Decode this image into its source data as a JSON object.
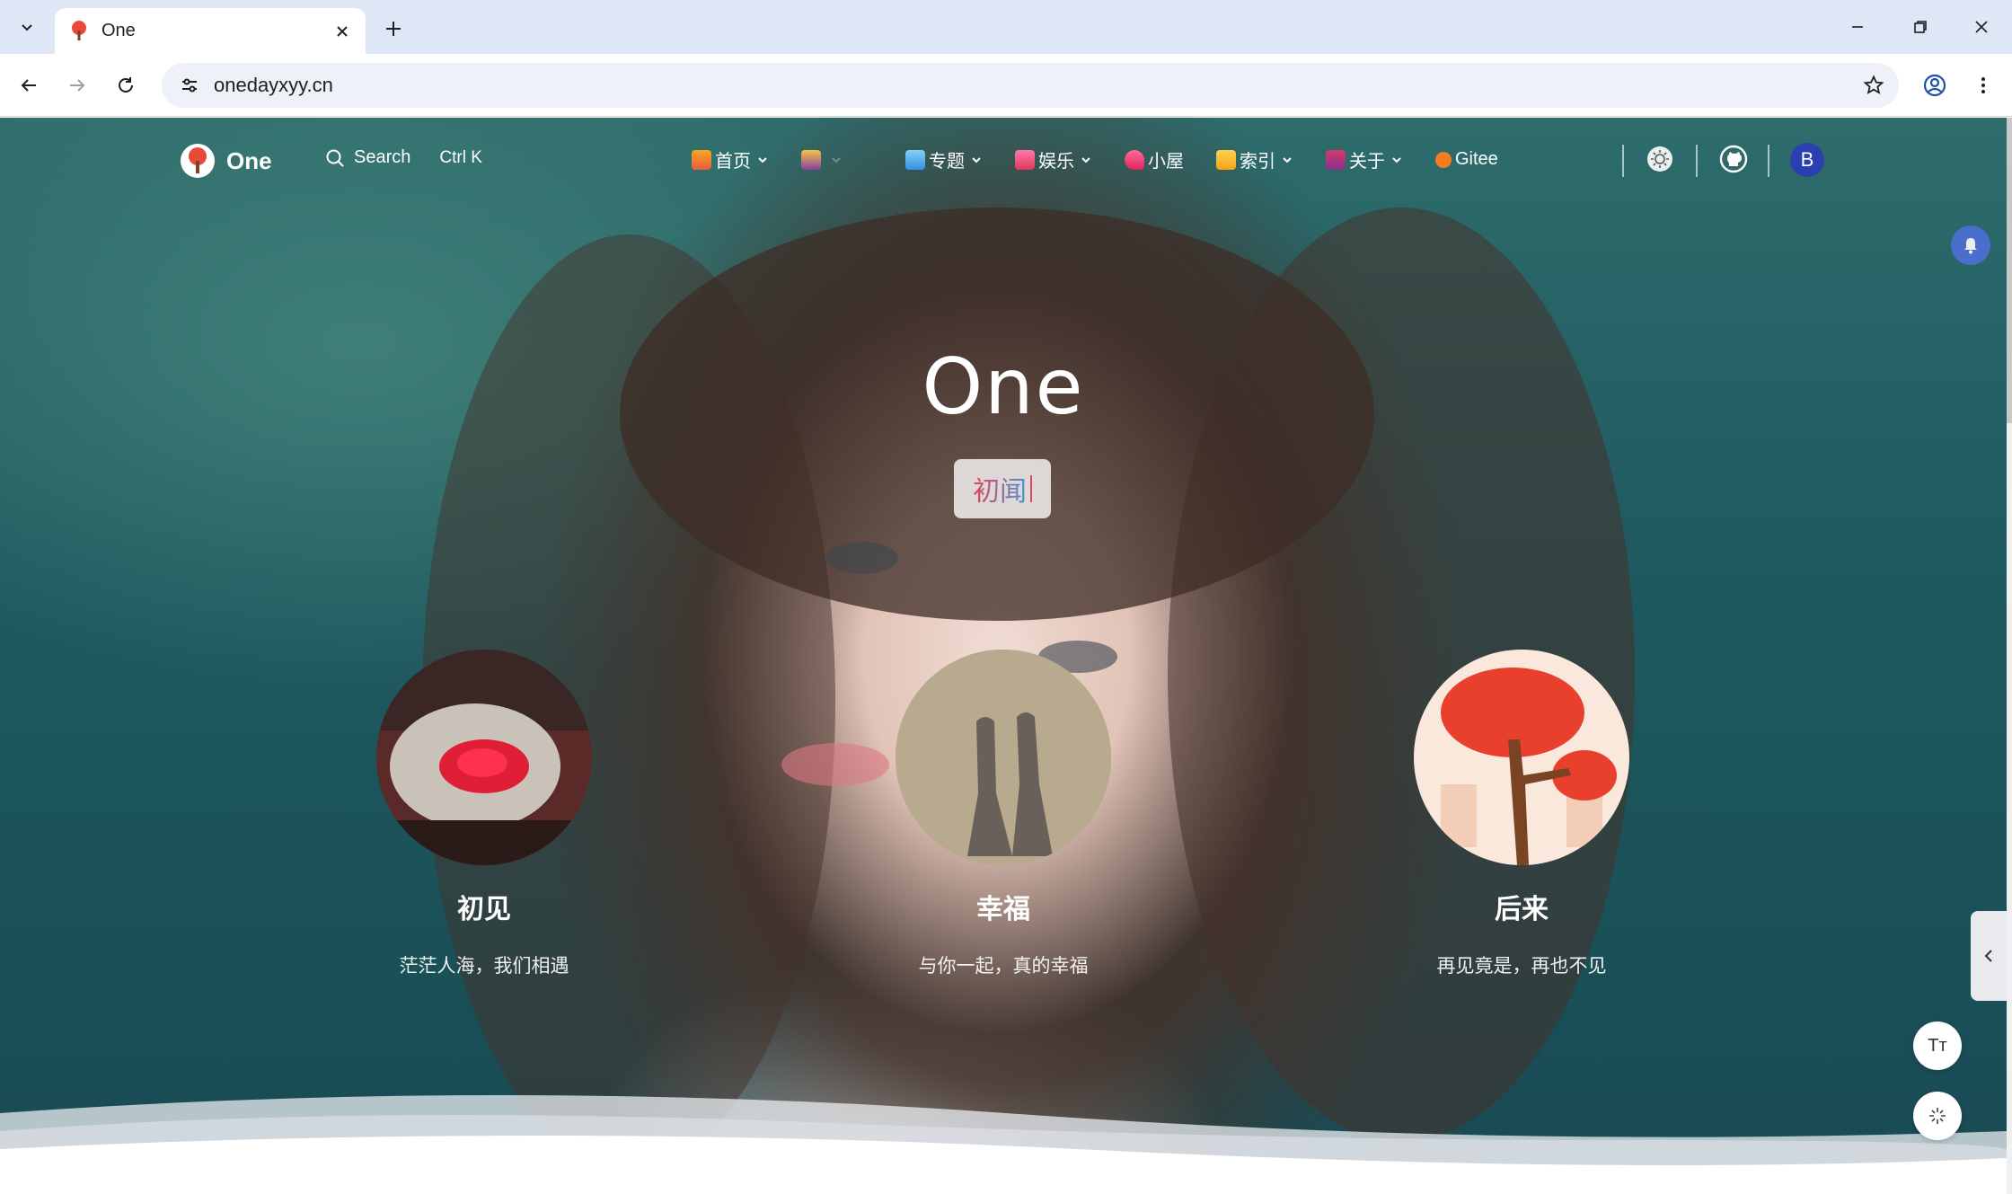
{
  "browser": {
    "tab_title": "One",
    "url": "onedayxyy.cn"
  },
  "site": {
    "logo_text": "One",
    "search_label": "Search",
    "search_shortcut": "Ctrl K",
    "nav": [
      {
        "label": "首页",
        "has_dropdown": true
      },
      {
        "label": "",
        "has_dropdown": true
      },
      {
        "label": "专题",
        "has_dropdown": true
      },
      {
        "label": "娱乐",
        "has_dropdown": true
      },
      {
        "label": "小屋",
        "has_dropdown": false
      },
      {
        "label": "索引",
        "has_dropdown": true
      },
      {
        "label": "关于",
        "has_dropdown": true
      },
      {
        "label": "Gitee",
        "has_dropdown": false
      }
    ],
    "avatar_letter": "B",
    "title": "One",
    "typed_text": "初闻"
  },
  "cards": [
    {
      "title": "初见",
      "desc": "茫茫人海，我们相遇"
    },
    {
      "title": "幸福",
      "desc": "与你一起，真的幸福"
    },
    {
      "title": "后来",
      "desc": "再见竟是，再也不见"
    }
  ],
  "floating": {
    "font_button": "Tт"
  },
  "colors": {
    "accent": "#2a3fb0",
    "bell": "#4f6fd8",
    "tab_bar": "#dfe7f6"
  }
}
